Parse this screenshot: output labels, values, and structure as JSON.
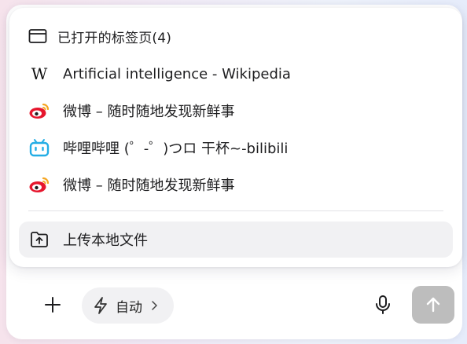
{
  "popup": {
    "header": {
      "label": "已打开的标签页(4)",
      "icon": "browser-tab-icon"
    },
    "tabs": [
      {
        "label": "Artificial intelligence - Wikipedia",
        "favicon": "wikipedia-icon",
        "favicon_text": "W"
      },
      {
        "label": "微博 – 随时随地发现新鲜事",
        "favicon": "weibo-icon"
      },
      {
        "label": "哔哩哔哩 (゜-゜)つロ 干杯~-bilibili",
        "favicon": "bilibili-icon"
      },
      {
        "label": "微博 – 随时随地发现新鲜事",
        "favicon": "weibo-icon"
      }
    ],
    "upload": {
      "label": "上传本地文件",
      "icon": "upload-file-icon"
    }
  },
  "composer": {
    "mode_label": "自动",
    "icons": [
      "plus-icon",
      "lightning-icon",
      "chevron-right-icon",
      "microphone-icon",
      "arrow-up-icon"
    ]
  },
  "colors": {
    "weibo_red": "#e6162d",
    "weibo_orange": "#f5a623",
    "bilibili_blue": "#23ade5",
    "send_disabled": "#bdbdbd",
    "pill_bg": "#f1f1f3"
  }
}
